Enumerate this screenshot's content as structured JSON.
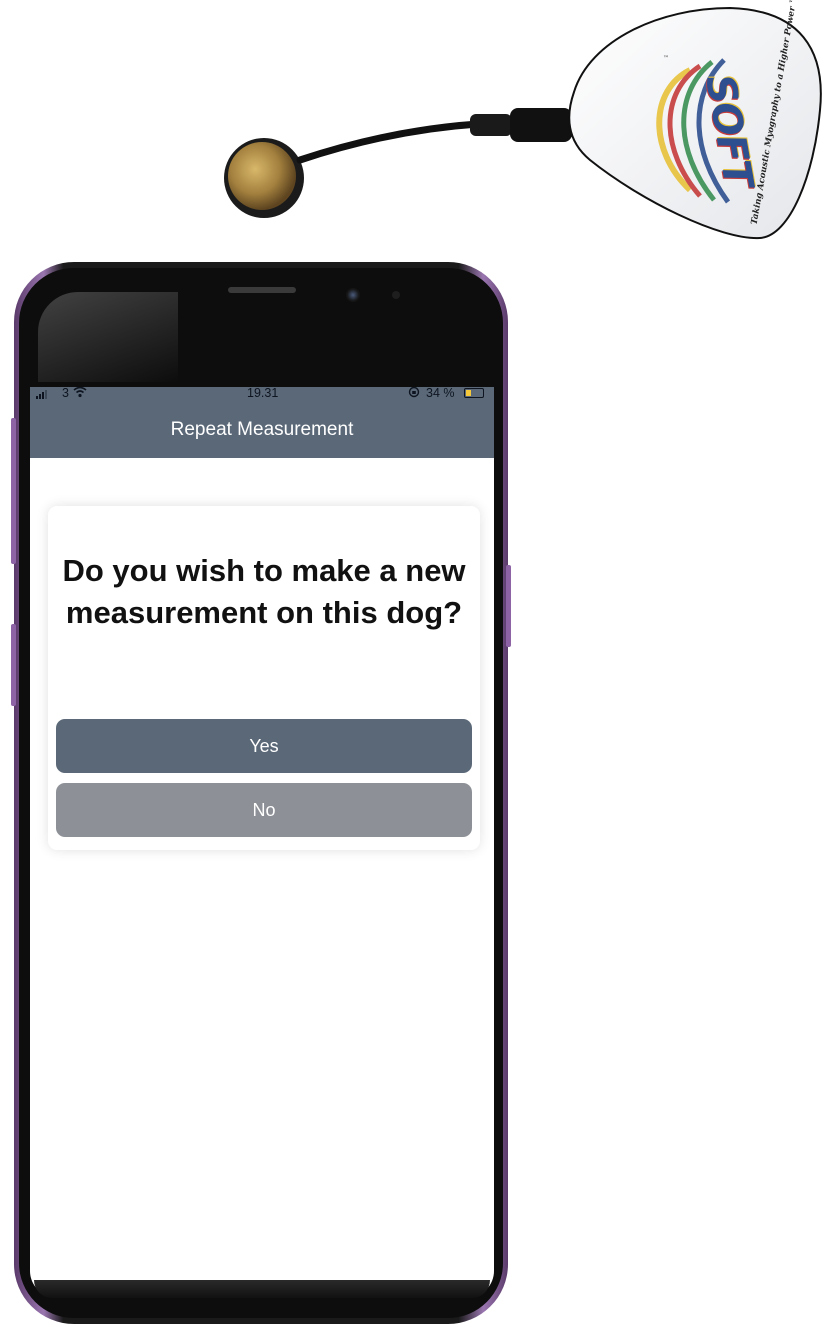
{
  "device": {
    "brand_logo": "SOFT",
    "trademark": "™",
    "tagline": "Taking Acoustic Myography to a Higher Power ™"
  },
  "status_bar": {
    "carrier": "3",
    "time": "19.31",
    "battery_percent_label": "34 %",
    "battery_level": 0.34,
    "signal_bars_active": 3,
    "signal_bars_total": 4
  },
  "header": {
    "title": "Repeat Measurement"
  },
  "dialog": {
    "question": "Do you wish to make a new measurement on this dog?",
    "yes_label": "Yes",
    "no_label": "No"
  },
  "colors": {
    "header_bg": "#5a6878",
    "yes_button": "#5a6878",
    "no_button": "#8d9197",
    "phone_frame": "#8d63a6",
    "battery": "#f5c93a"
  },
  "icons": {
    "signal": "signal-bars-icon",
    "wifi": "wifi-icon",
    "rotation_lock": "rotation-lock-icon",
    "battery": "battery-icon"
  }
}
